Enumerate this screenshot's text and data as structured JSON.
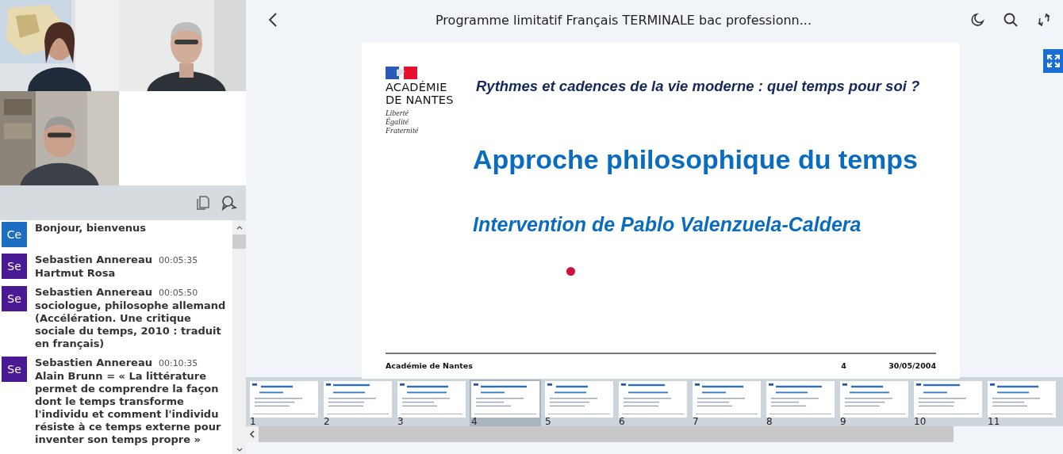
{
  "chat": {
    "messages": [
      {
        "initials": "Ce",
        "color": "#1b6ec2",
        "text": "Bonjour, bienvenus"
      },
      {
        "initials": "Se",
        "color": "#4a1a95",
        "author": "Sebastien Annereau",
        "time": "00:05:35",
        "text": "Hartmut Rosa"
      },
      {
        "initials": "Se",
        "color": "#4a1a95",
        "author": "Sebastien Annereau",
        "time": "00:05:50",
        "text": "sociologue, philosophe allemand (Accélération. Une critique sociale du temps, 2010 : traduit en français)"
      },
      {
        "initials": "Se",
        "color": "#4a1a95",
        "author": "Sebastien Annereau",
        "time": "00:10:35",
        "text": "Alain Brunn = « La littérature permet de comprendre la façon dont le temps transforme l'individu et comment l'individu résiste à ce temps externe pour inventer son temps propre »"
      }
    ]
  },
  "header": {
    "title": "Programme limitatif Français TERMINALE bac professionn..."
  },
  "slide": {
    "logo": {
      "line1": "ACADÉMIE",
      "line2": "DE NANTES",
      "motto": [
        "Liberté",
        "Égalité",
        "Fraternité"
      ]
    },
    "heading": "Rythmes et cadences de la vie moderne : quel temps pour soi ?",
    "title": "Approche philosophique du temps",
    "subtitle": "Intervention de Pablo Valenzuela-Caldera",
    "footer": {
      "left": "Académie de Nantes",
      "page": "4",
      "date": "30/05/2004"
    }
  },
  "thumbnails": [
    {
      "number": "1",
      "selected": false
    },
    {
      "number": "2",
      "selected": false
    },
    {
      "number": "3",
      "selected": false
    },
    {
      "number": "4",
      "selected": true
    },
    {
      "number": "5",
      "selected": false
    },
    {
      "number": "6",
      "selected": false
    },
    {
      "number": "7",
      "selected": false
    },
    {
      "number": "8",
      "selected": false
    },
    {
      "number": "9",
      "selected": false
    },
    {
      "number": "10",
      "selected": false
    },
    {
      "number": "11",
      "selected": false
    }
  ]
}
